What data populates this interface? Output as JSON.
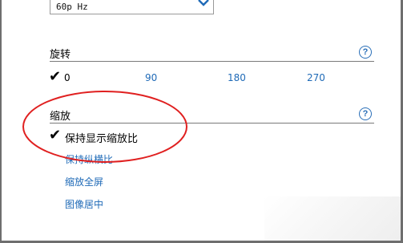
{
  "refresh": {
    "value": "60p Hz"
  },
  "rotation": {
    "title": "旋转",
    "help_symbol": "?",
    "options": [
      "0",
      "90",
      "180",
      "270"
    ],
    "selected": "0"
  },
  "scaling": {
    "title": "缩放",
    "help_symbol": "?",
    "options": [
      "保持显示缩放比",
      "保持纵横比",
      "缩放全屏",
      "图像居中"
    ],
    "selected": "保持显示缩放比"
  },
  "annotation_color": "#e02020",
  "link_color": "#1f6ab7"
}
